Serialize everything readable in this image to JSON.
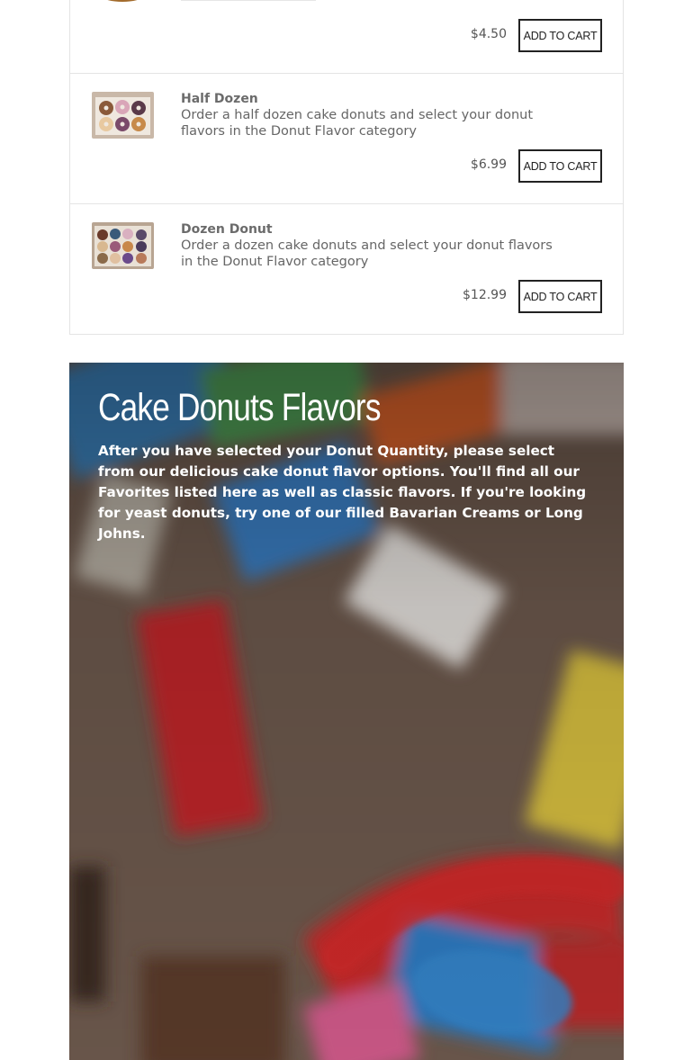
{
  "products": [
    {
      "price": "$4.50",
      "button_label": "ADD TO CART"
    },
    {
      "name": "Half Dozen",
      "description": "Order a half dozen cake donuts and select your donut flavors in the Donut Flavor category",
      "price": "$6.99",
      "button_label": "ADD TO CART"
    },
    {
      "name": "Dozen Donut",
      "description": "Order a dozen cake donuts and select your donut flavors in the Donut Flavor category",
      "price": "$12.99",
      "button_label": "ADD TO CART"
    }
  ],
  "flavors_section": {
    "title": "Cake Donuts Flavors",
    "text": "After you have selected your Donut Quantity, please select from our delicious cake donut flavor options. You'll find all our Favorites listed here as well as classic flavors. If you're looking for yeast donuts, try one of our filled Bavarian Creams or Long Johns."
  }
}
